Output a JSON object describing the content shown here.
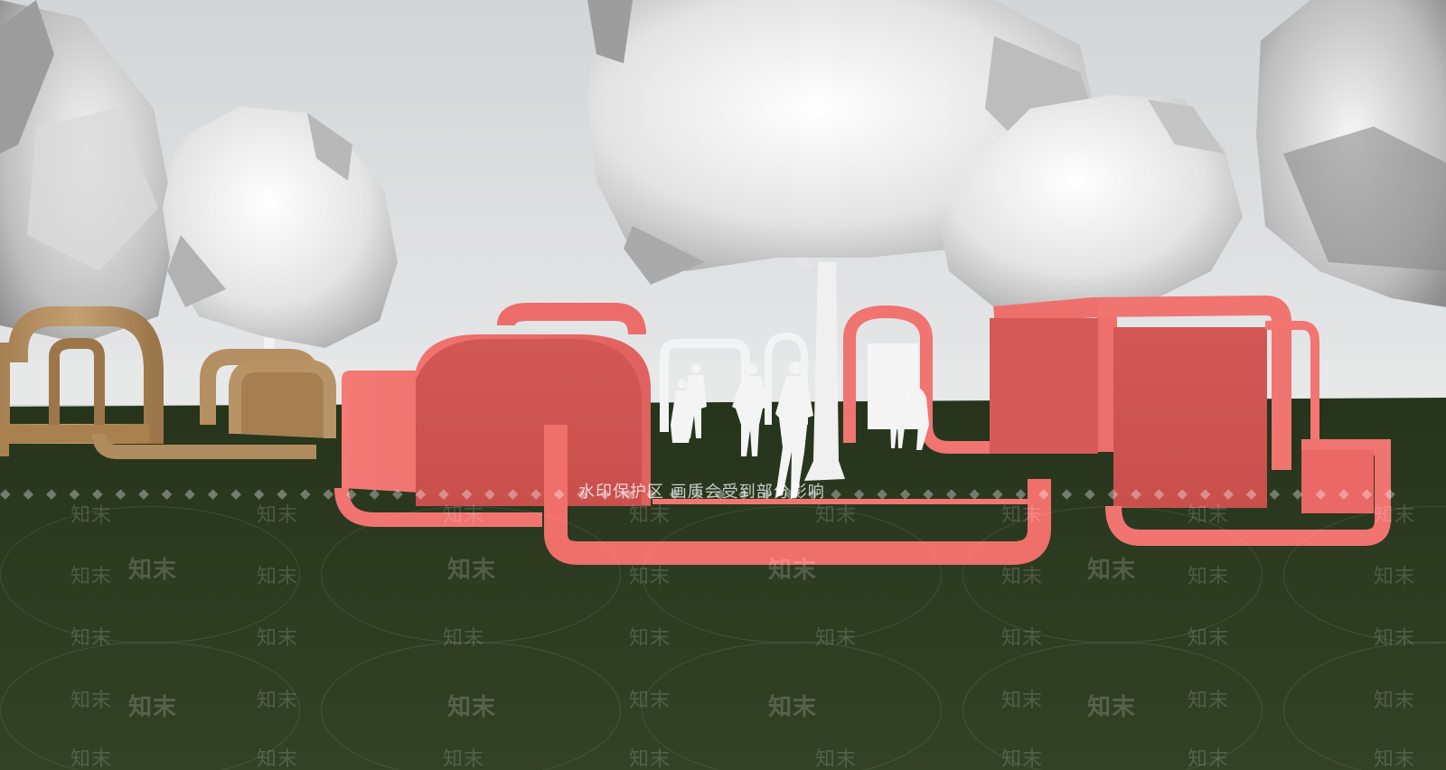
{
  "scene": {
    "sky_color": "#d6d9db",
    "ground_color": "#2d3b22",
    "pink_color": "#f2716e",
    "wood_color": "#b99466",
    "tree_color": "#e6e6e6"
  },
  "watermark": {
    "brand": "知末",
    "notice": "水印保护区  画质会受到部分影响"
  }
}
